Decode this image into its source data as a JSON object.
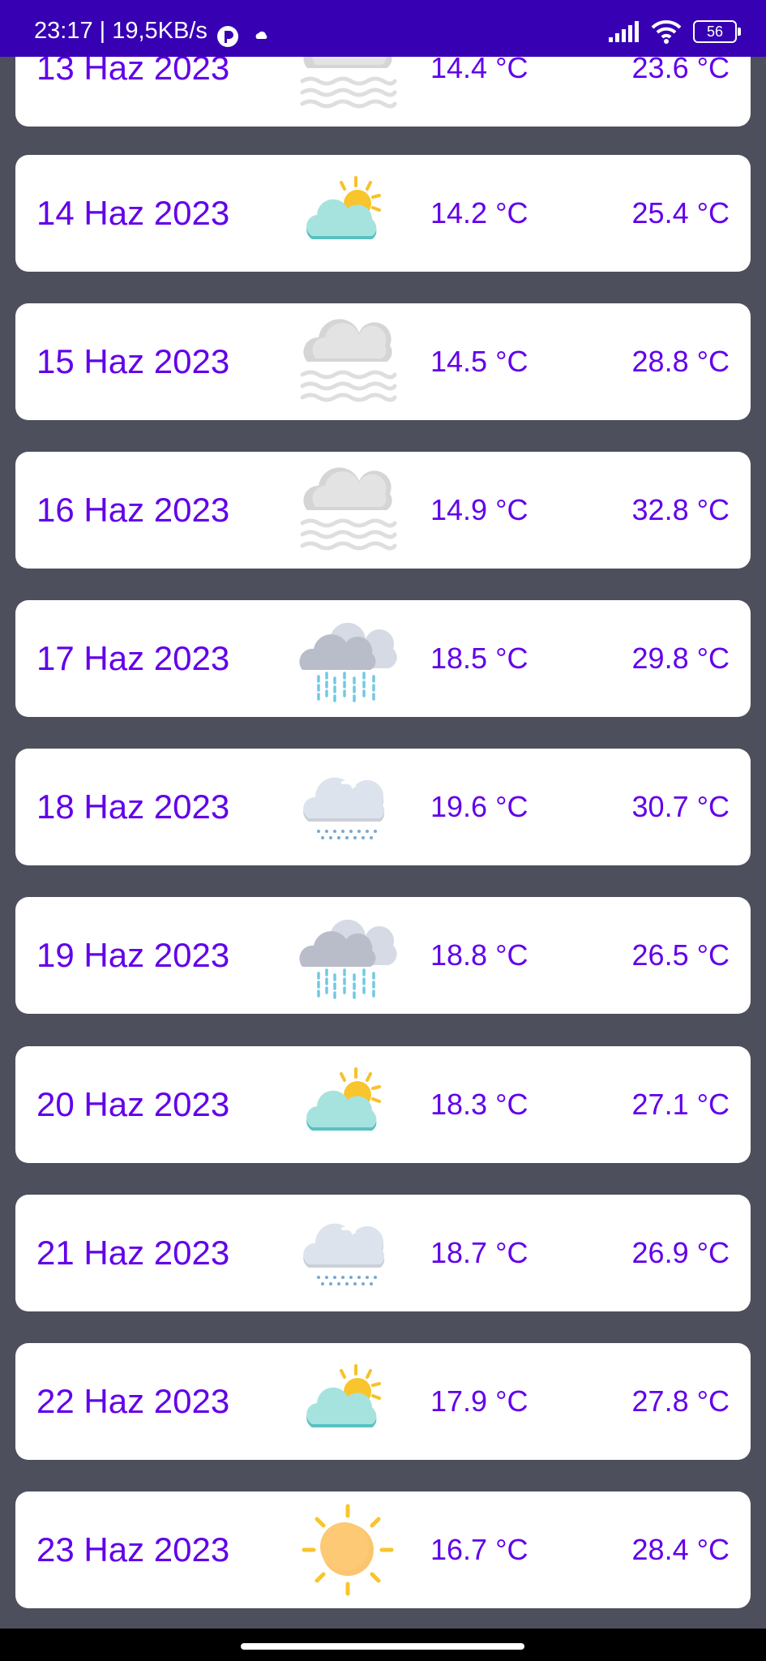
{
  "status_bar": {
    "time_speed": "23:17 | 19,5KB/s",
    "battery": "56",
    "icons": [
      "vpn-icon",
      "cloud-icon",
      "signal-icon",
      "wifi-icon",
      "battery-icon"
    ]
  },
  "forecast": [
    {
      "date": "13 Haz 2023",
      "icon": "fog-icon",
      "min": "14.4 °C",
      "max": "23.6 °C"
    },
    {
      "date": "14 Haz 2023",
      "icon": "partly-cloudy-icon",
      "min": "14.2 °C",
      "max": "25.4 °C"
    },
    {
      "date": "15 Haz 2023",
      "icon": "fog-icon",
      "min": "14.5 °C",
      "max": "28.8 °C"
    },
    {
      "date": "16 Haz 2023",
      "icon": "fog-icon",
      "min": "14.9 °C",
      "max": "32.8 °C"
    },
    {
      "date": "17 Haz 2023",
      "icon": "heavy-rain-icon",
      "min": "18.5 °C",
      "max": "29.8 °C"
    },
    {
      "date": "18 Haz 2023",
      "icon": "drizzle-icon",
      "min": "19.6 °C",
      "max": "30.7 °C"
    },
    {
      "date": "19 Haz 2023",
      "icon": "heavy-rain-icon",
      "min": "18.8 °C",
      "max": "26.5 °C"
    },
    {
      "date": "20 Haz 2023",
      "icon": "partly-cloudy-icon",
      "min": "18.3 °C",
      "max": "27.1 °C"
    },
    {
      "date": "21 Haz 2023",
      "icon": "drizzle-icon",
      "min": "18.7 °C",
      "max": "26.9 °C"
    },
    {
      "date": "22 Haz 2023",
      "icon": "partly-cloudy-icon",
      "min": "17.9 °C",
      "max": "27.8 °C"
    },
    {
      "date": "23 Haz 2023",
      "icon": "sunny-icon",
      "min": "16.7 °C",
      "max": "28.4 °C"
    }
  ],
  "colors": {
    "accent": "#6200ea",
    "status_bar": "#3700b3",
    "background": "#4d4f5c",
    "card": "#ffffff"
  }
}
